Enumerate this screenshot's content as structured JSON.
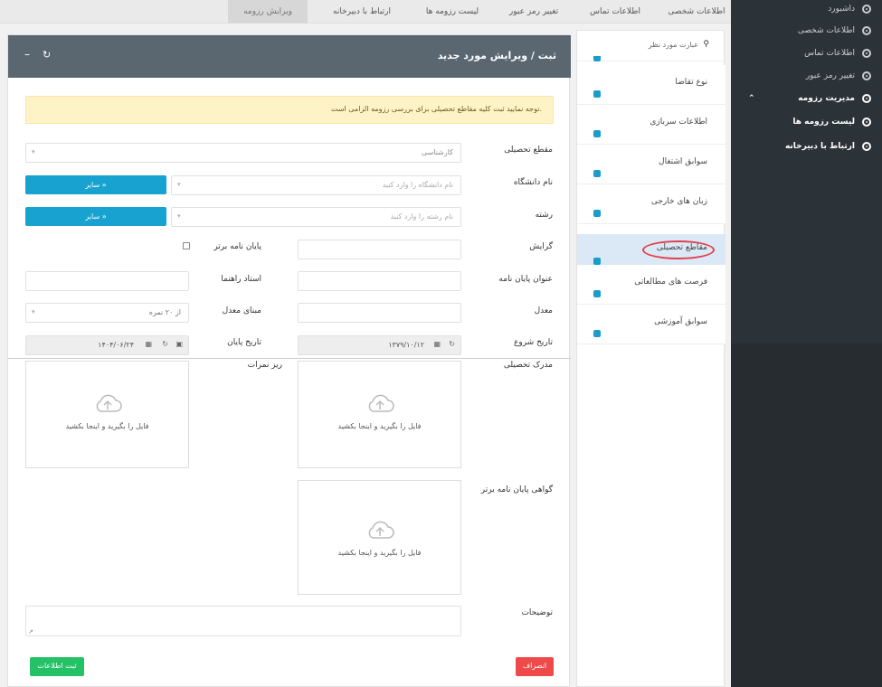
{
  "sidebar": {
    "items": [
      {
        "label": "داشبورد"
      },
      {
        "label": "اطلاعات شخصی"
      },
      {
        "label": "اطلاعات تماس"
      },
      {
        "label": "تغییر رمز عبور"
      },
      {
        "label": "مدیریت رزومه"
      },
      {
        "label": "لیست رزومه ها"
      },
      {
        "label": "ارتباط با دبیرخانه"
      }
    ]
  },
  "tabs": [
    {
      "label": "اطلاعات شخصی"
    },
    {
      "label": "اطلاعات تماس"
    },
    {
      "label": "تغییر رمز عبور"
    },
    {
      "label": "لیست رزومه ها"
    },
    {
      "label": "ارتباط با دبیرخانه"
    },
    {
      "label": "ویرایش رزومه"
    }
  ],
  "panel": {
    "title": "ثبت / ویرایش مورد جدید"
  },
  "alert": "توجه نمایید ثبت کلیه مقاطع تحصیلی برای بررسی رزومه الزامی است.",
  "form": {
    "degree_label": "مقطع تحصیلی",
    "degree_value": "کارشناسی",
    "university_label": "نام دانشگاه",
    "university_placeholder": "نام دانشگاه را وارد کنید",
    "other_btn": "سایر",
    "major_label": "رشته",
    "major_placeholder": "نام رشته را وارد کنید",
    "branch_label": "گرایش",
    "top_thesis_label": "پایان نامه برتر",
    "thesis_title_label": "عنوان پایان نامه",
    "advisor_label": "استاد راهنما",
    "gpa_label": "معدل",
    "gpa_basis_label": "مبنای معدل",
    "gpa_basis_value": "از ۲۰ نمره",
    "start_date_label": "تاریخ شروع",
    "start_date_value": "۱۳۷۹/۱۰/۱۲",
    "end_date_label": "تاریخ پایان",
    "end_date_value": "۱۴۰۴/۰۶/۲۴",
    "certificate_label": "مدرک تحصیلی",
    "transcript_label": "ریز نمرات",
    "top_thesis_cert_label": "گواهی پایان نامه برتر",
    "upload_text": "فایل را بگیرید و اینجا بکشید",
    "notes_label": "توضیحات",
    "cancel_btn": "انصراف",
    "submit_btn": "ثبت اطلاعات"
  },
  "list": {
    "search_placeholder": "عبارت مورد نظر",
    "items": [
      {
        "label": "نوع تقاضا"
      },
      {
        "label": "اطلاعات سربازی"
      },
      {
        "label": "سوابق اشتغال"
      },
      {
        "label": "زبان های خارجی"
      },
      {
        "label": "مقاطع تحصیلی"
      },
      {
        "label": "فرصت های مطالعاتی"
      },
      {
        "label": "سوابق آموزشی"
      }
    ]
  },
  "colors": {
    "accent": "#17a2cf",
    "header": "#5a6670",
    "danger": "#ee4a4a",
    "success": "#24c167",
    "sidebar": "#2c3338"
  }
}
